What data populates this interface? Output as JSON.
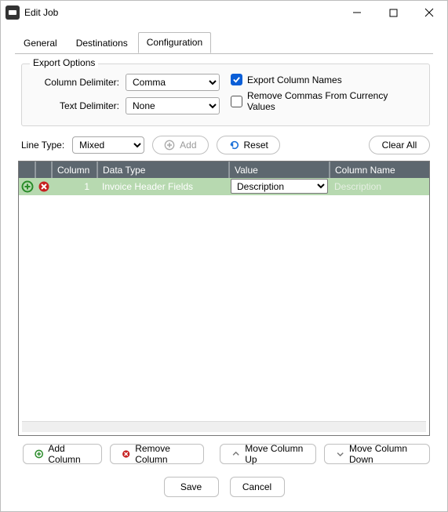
{
  "window": {
    "title": "Edit Job"
  },
  "tabs": [
    {
      "label": "General",
      "active": false
    },
    {
      "label": "Destinations",
      "active": false
    },
    {
      "label": "Configuration",
      "active": true
    }
  ],
  "exportOptions": {
    "title": "Export Options",
    "columnDelimiterLabel": "Column Delimiter:",
    "columnDelimiterValue": "Comma",
    "textDelimiterLabel": "Text Delimiter:",
    "textDelimiterValue": "None",
    "exportColumnNamesLabel": "Export Column Names",
    "exportColumnNamesChecked": true,
    "removeCommasLabel": "Remove Commas From Currency Values",
    "removeCommasChecked": false
  },
  "toolbar": {
    "lineTypeLabel": "Line Type:",
    "lineTypeValue": "Mixed",
    "addLabel": "Add",
    "resetLabel": "Reset",
    "clearAllLabel": "Clear All"
  },
  "grid": {
    "headers": {
      "column": "Column",
      "dataType": "Data Type",
      "value": "Value",
      "columnName": "Column Name"
    },
    "rows": [
      {
        "column": "1",
        "dataType": "Invoice Header Fields",
        "value": "Description",
        "columnName": "Description"
      }
    ]
  },
  "columnButtons": {
    "add": "Add Column",
    "remove": "Remove Column",
    "up": "Move Column Up",
    "down": "Move Column Down"
  },
  "dialog": {
    "save": "Save",
    "cancel": "Cancel"
  }
}
